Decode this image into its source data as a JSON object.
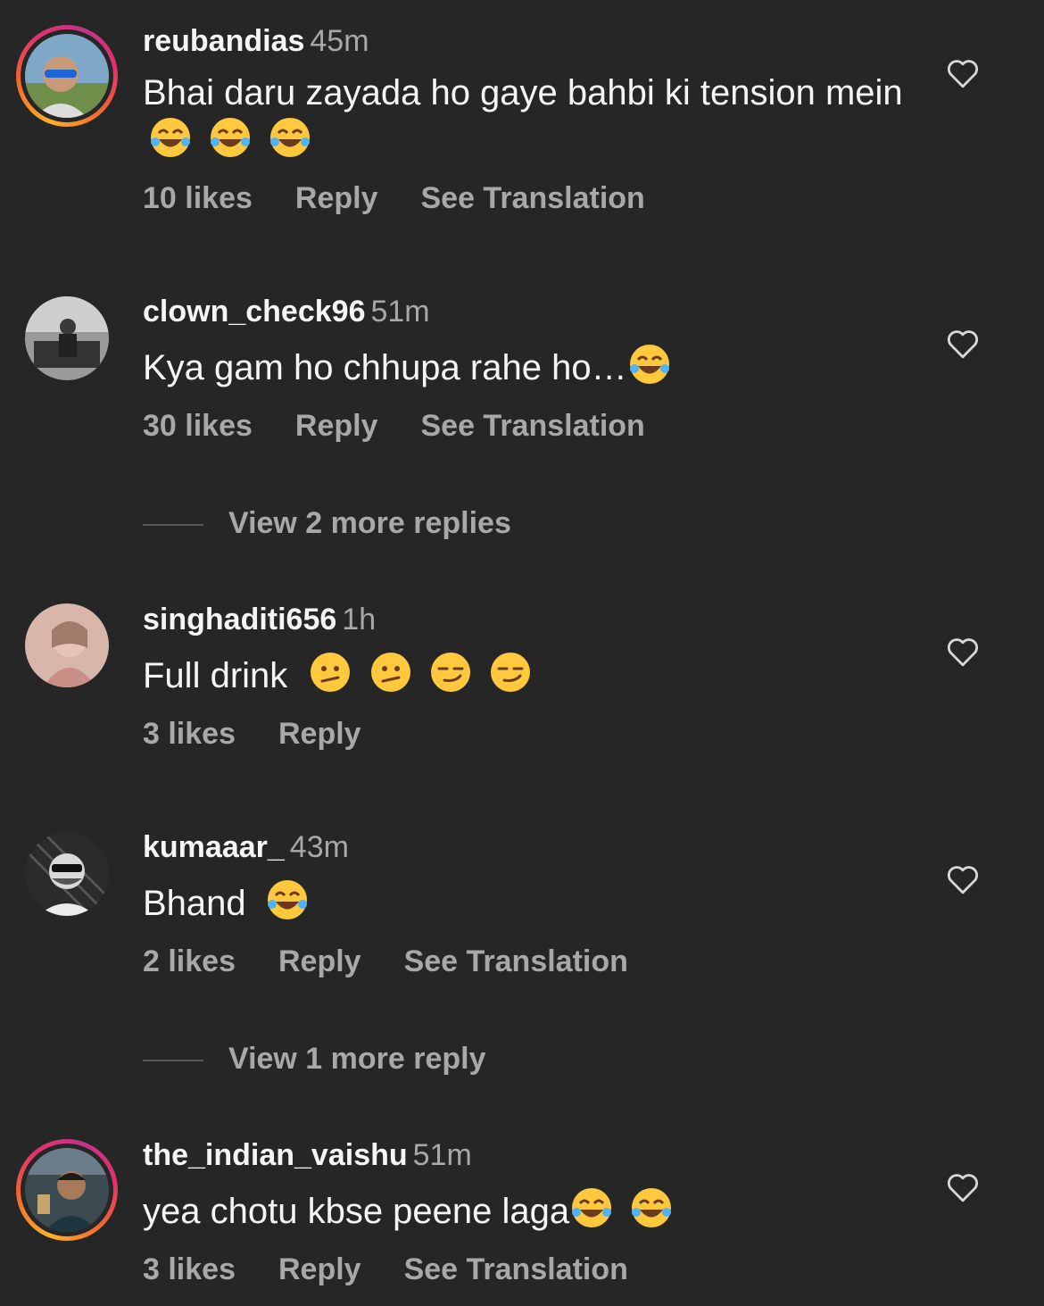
{
  "comments": [
    {
      "username": "reubandias",
      "time": "45m",
      "text": "Bhai daru zayada ho gaye bahbi ki tension mein",
      "emojis": [
        "joy-emoji",
        "joy-emoji",
        "joy-emoji"
      ],
      "likes": "10 likes",
      "reply": "Reply",
      "translation": "See Translation",
      "story_ring": true
    },
    {
      "username": "clown_check96",
      "time": "51m",
      "text": "Kya gam ho chhupa rahe ho…",
      "emojis": [
        "joy-emoji"
      ],
      "likes": "30 likes",
      "reply": "Reply",
      "translation": "See Translation",
      "more_replies": "View 2 more replies",
      "story_ring": false
    },
    {
      "username": "singhaditi656",
      "time": "1h",
      "text": "Full drink",
      "emojis": [
        "confused-emoji",
        "confused-emoji",
        "smirk-emoji",
        "smirk-emoji"
      ],
      "likes": "3 likes",
      "reply": "Reply",
      "story_ring": false
    },
    {
      "username": "kumaaar_",
      "time": "43m",
      "text": "Bhand",
      "emojis": [
        "joy-emoji"
      ],
      "likes": "2 likes",
      "reply": "Reply",
      "translation": "See Translation",
      "more_replies": "View 1 more reply",
      "story_ring": false
    },
    {
      "username": "the_indian_vaishu",
      "time": "51m",
      "text": "yea chotu kbse peene laga",
      "emojis": [
        "joy-emoji",
        "joy-emoji"
      ],
      "likes": "3 likes",
      "reply": "Reply",
      "translation": "See Translation",
      "story_ring": true
    }
  ],
  "colors": {
    "background": "#262626",
    "primary_text": "#f5f5f5",
    "secondary_text": "#a8a8a8"
  }
}
